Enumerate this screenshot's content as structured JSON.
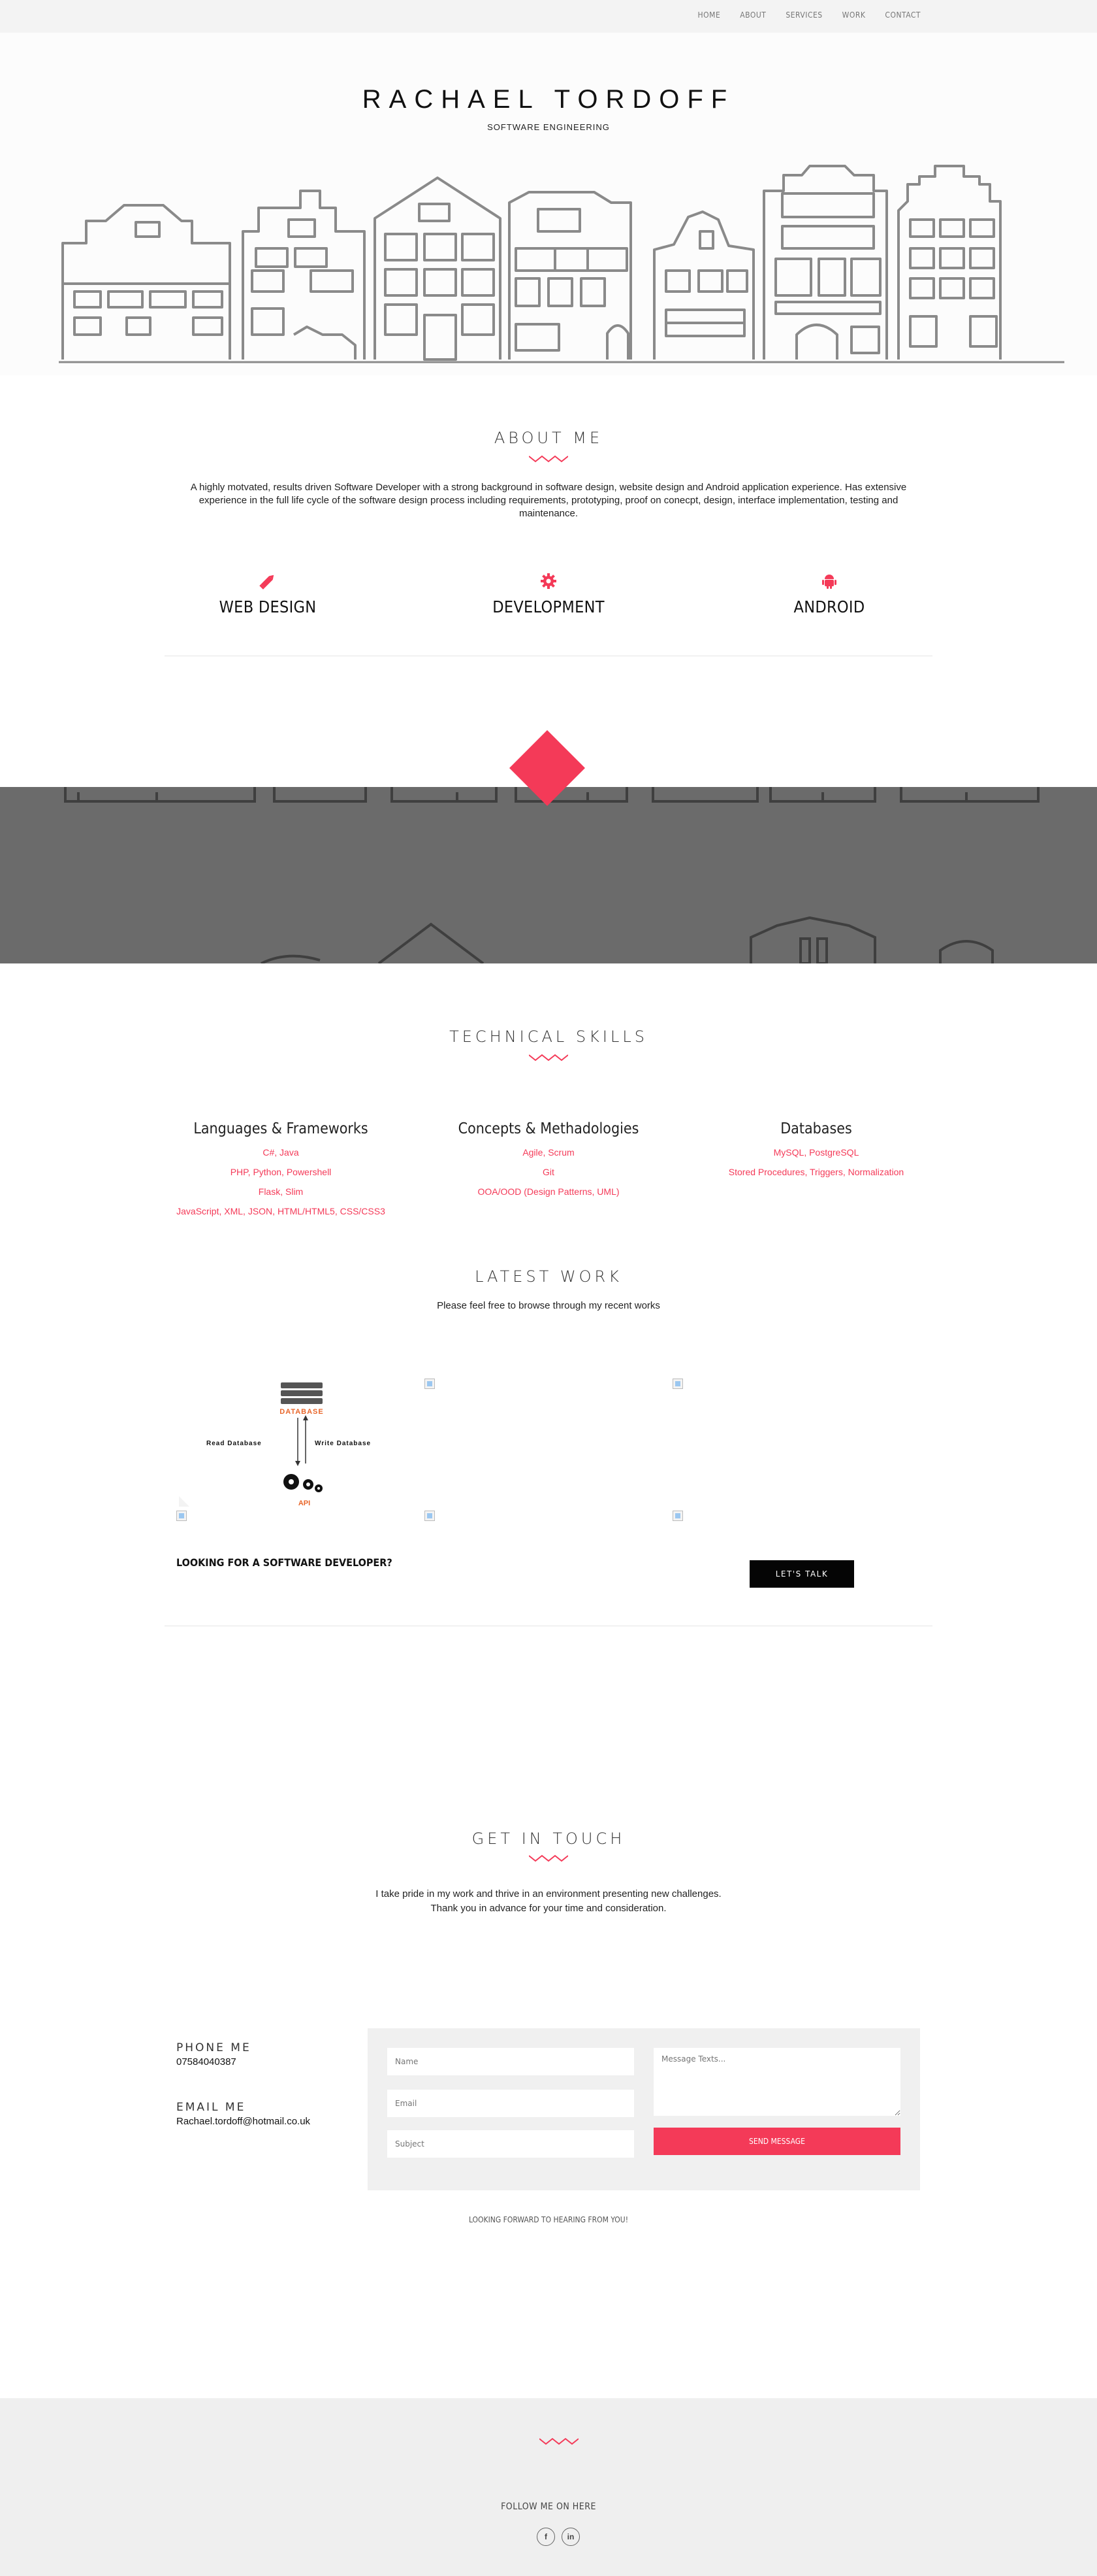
{
  "nav": {
    "items": [
      "HOME",
      "ABOUT",
      "SERVICES",
      "WORK",
      "CONTACT"
    ]
  },
  "hero": {
    "title": "RACHAEL TORDOFF",
    "subtitle": "SOFTWARE ENGINEERING"
  },
  "about": {
    "heading": "ABOUT ME",
    "text": "A highly motvated, results driven Software Developer with a strong background in software design, website design and Android application experience. Has extensive experience in the full life cycle of the software design process including requirements, prototyping, proof on conecpt, design, interface implementation, testing and maintenance.",
    "services": [
      {
        "label": "WEB DESIGN",
        "icon": "pencil-icon"
      },
      {
        "label": "DEVELOPMENT",
        "icon": "gear-icon"
      },
      {
        "label": "ANDROID",
        "icon": "android-icon"
      }
    ]
  },
  "skills": {
    "heading": "TECHNICAL SKILLS",
    "columns": [
      {
        "title": "Languages & Frameworks",
        "items": [
          "C#, Java",
          "PHP, Python, Powershell",
          "Flask, Slim",
          "JavaScript, XML, JSON, HTML/HTML5, CSS/CSS3"
        ]
      },
      {
        "title": "Concepts & Methadologies",
        "items": [
          "Agile, Scrum",
          "Git",
          "OOA/OOD (Design Patterns, UML)"
        ]
      },
      {
        "title": "Databases",
        "items": [
          "MySQL, PostgreSQL",
          "Stored Procedures, Triggers, Normalization"
        ]
      }
    ]
  },
  "work": {
    "heading": "LATEST WORK",
    "subtitle": "Please feel free to browse through my recent works",
    "diagram": {
      "top": "DATABASE",
      "left": "Read Database",
      "right": "Write Database",
      "bottom": "API"
    },
    "hire_text": "LOOKING FOR A SOFTWARE DEVELOPER?",
    "talk_button": "LET'S TALK"
  },
  "contact": {
    "heading": "GET IN TOUCH",
    "intro_line1": "I take pride in my work and thrive in an environment presenting new challenges.",
    "intro_line2": "Thank you in advance for your time and consideration.",
    "phone_title": "PHONE ME",
    "phone": "07584040387",
    "email_title": "EMAIL ME",
    "email": "Rachael.tordoff@hotmail.co.uk",
    "form": {
      "name_placeholder": "Name",
      "email_placeholder": "Email",
      "subject_placeholder": "Subject",
      "message_placeholder": "Message Texts...",
      "send_label": "SEND MESSAGE"
    },
    "looking_forward": "LOOKING FORWARD TO HEARING FROM YOU!"
  },
  "footer": {
    "follow": "FOLLOW ME ON HERE",
    "socials": [
      {
        "icon": "facebook-icon",
        "glyph": "f"
      },
      {
        "icon": "linkedin-icon",
        "glyph": "in"
      }
    ]
  },
  "colors": {
    "accent": "#f43a58",
    "band": "#6b6b6b",
    "nav_bg": "#f3f3f3",
    "footer_bg": "#efefef"
  }
}
